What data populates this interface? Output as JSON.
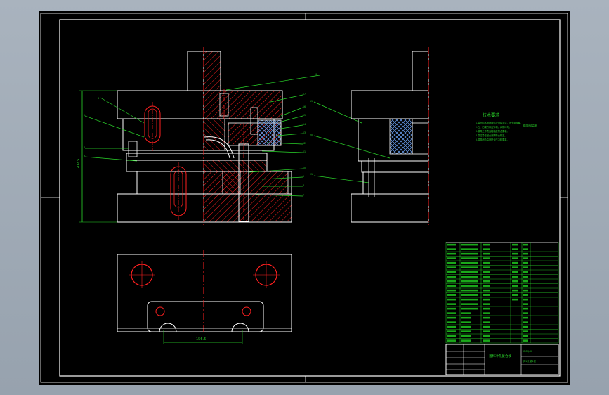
{
  "notes": {
    "title": "技术要求",
    "lines": [
      "1.装配后各运动部件应运动灵活，无卡滞现象。",
      "2.凸、凹模刃口应锋利，间隙均匀。",
      "3.模具工作表面粗糙度符合要求。",
      "4.导柱导套配合间隙符合规定。",
      "5.模具闭合高度符合压力机要求。"
    ],
    "side": "模具闭合高度"
  },
  "dimensions": {
    "height": "202.5",
    "width": "156.5"
  },
  "title_block": {
    "drawing_title": "落料冲孔复合模",
    "drawing_code": "CMSJ-00",
    "sheet_info": "共1张 第1张"
  },
  "colors": {
    "line": "#ffffff",
    "green": "#2bd92b",
    "red": "#ff2020",
    "hatch": "#ff2020",
    "cross": "#6fa8ff"
  }
}
